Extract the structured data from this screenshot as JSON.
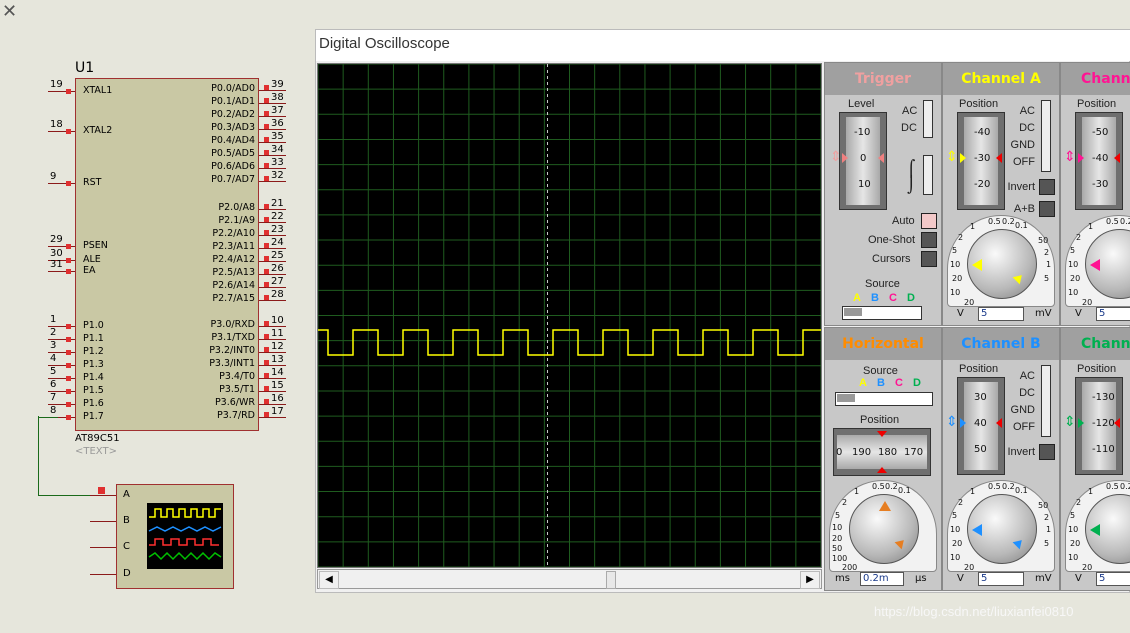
{
  "schematic": {
    "close_glyph": "✕",
    "ref": "U1",
    "part": "AT89C51",
    "text_placeholder": "<TEXT>",
    "left_pins": [
      {
        "num": "19",
        "name": "XTAL1"
      },
      {
        "num": "18",
        "name": "XTAL2"
      },
      {
        "num": "9",
        "name": "RST"
      },
      {
        "num": "29",
        "name": "PSEN"
      },
      {
        "num": "30",
        "name": "ALE"
      },
      {
        "num": "31",
        "name": "EA"
      },
      {
        "num": "1",
        "name": "P1.0"
      },
      {
        "num": "2",
        "name": "P1.1"
      },
      {
        "num": "3",
        "name": "P1.2"
      },
      {
        "num": "4",
        "name": "P1.3"
      },
      {
        "num": "5",
        "name": "P1.4"
      },
      {
        "num": "6",
        "name": "P1.5"
      },
      {
        "num": "7",
        "name": "P1.6"
      },
      {
        "num": "8",
        "name": "P1.7"
      }
    ],
    "right_pins": [
      {
        "num": "39",
        "name": "P0.0/AD0"
      },
      {
        "num": "38",
        "name": "P0.1/AD1"
      },
      {
        "num": "37",
        "name": "P0.2/AD2"
      },
      {
        "num": "36",
        "name": "P0.3/AD3"
      },
      {
        "num": "35",
        "name": "P0.4/AD4"
      },
      {
        "num": "34",
        "name": "P0.5/AD5"
      },
      {
        "num": "33",
        "name": "P0.6/AD6"
      },
      {
        "num": "32",
        "name": "P0.7/AD7"
      },
      {
        "num": "21",
        "name": "P2.0/A8"
      },
      {
        "num": "22",
        "name": "P2.1/A9"
      },
      {
        "num": "23",
        "name": "P2.2/A10"
      },
      {
        "num": "24",
        "name": "P2.3/A11"
      },
      {
        "num": "25",
        "name": "P2.4/A12"
      },
      {
        "num": "26",
        "name": "P2.5/A13"
      },
      {
        "num": "27",
        "name": "P2.6/A14"
      },
      {
        "num": "28",
        "name": "P2.7/A15"
      },
      {
        "num": "10",
        "name": "P3.0/RXD"
      },
      {
        "num": "11",
        "name": "P3.1/TXD"
      },
      {
        "num": "12",
        "name": "P3.2/INT0"
      },
      {
        "num": "13",
        "name": "P3.3/INT1"
      },
      {
        "num": "14",
        "name": "P3.4/T0"
      },
      {
        "num": "15",
        "name": "P3.5/T1"
      },
      {
        "num": "16",
        "name": "P3.6/WR"
      },
      {
        "num": "17",
        "name": "P3.7/RD"
      }
    ],
    "scope_inputs": [
      "A",
      "B",
      "C",
      "D"
    ]
  },
  "oscilloscope": {
    "title": "Digital Oscilloscope",
    "trigger": {
      "title": "Trigger",
      "level_label": "Level",
      "level_ticks": [
        "-10",
        "0",
        "10"
      ],
      "coupling": [
        "AC",
        "DC"
      ],
      "auto_label": "Auto",
      "one_shot_label": "One-Shot",
      "cursors_label": "Cursors",
      "source_label": "Source",
      "sources": [
        "A",
        "B",
        "C",
        "D"
      ]
    },
    "horizontal": {
      "title": "Horizontal",
      "source_label": "Source",
      "sources": [
        "A",
        "B",
        "C",
        "D"
      ],
      "position_label": "Position",
      "position_ticks": [
        "0",
        "190",
        "180",
        "170"
      ],
      "knob_ticks": [
        "0.5",
        "0.2",
        "0.1",
        "1",
        "2",
        "5",
        "10",
        "20",
        "50",
        "100",
        "200"
      ],
      "value": "0.2m",
      "unit_left": "ms",
      "unit_right": "μs"
    },
    "channels": [
      {
        "title": "Channel A",
        "color": "#ffff00",
        "position_label": "Position",
        "ticks": [
          "-40",
          "-30",
          "-20"
        ],
        "coupling": [
          "AC",
          "DC",
          "GND",
          "OFF"
        ],
        "invert_label": "Invert",
        "aplusb_label": "A+B",
        "value": "5",
        "unit_left": "V",
        "unit_right": "mV"
      },
      {
        "title": "Channel B",
        "color": "#1e90ff",
        "position_label": "Position",
        "ticks": [
          "30",
          "40",
          "50"
        ],
        "coupling": [
          "AC",
          "DC",
          "GND",
          "OFF"
        ],
        "invert_label": "Invert",
        "value": "5",
        "unit_left": "V",
        "unit_right": "mV"
      },
      {
        "title": "Channe",
        "color": "#ff1493",
        "position_label": "Position",
        "ticks": [
          "-50",
          "-40",
          "-30"
        ],
        "value": "5",
        "unit_left": "V"
      },
      {
        "title": "Channe",
        "color": "#00b050",
        "position_label": "Position",
        "ticks": [
          "-130",
          "-120",
          "-110"
        ],
        "value": "5",
        "unit_left": "V"
      }
    ],
    "knob_ticks_vertical": [
      "0.5",
      "0.2",
      "0.1",
      "1",
      "2",
      "5",
      "10",
      "20",
      "50",
      "2",
      "1",
      "5",
      "10",
      "20"
    ]
  },
  "watermark": "https://blog.csdn.net/liuxianfei0810",
  "colors": {
    "trace": "#ffff00",
    "grid": "#1f5c1f",
    "trigger_title": "#f0a0a0",
    "horizontal_title": "#ff8c00",
    "channel_a": "#ffff00",
    "channel_b": "#1e90ff",
    "channel_c": "#ff1493",
    "channel_d": "#00b050"
  }
}
